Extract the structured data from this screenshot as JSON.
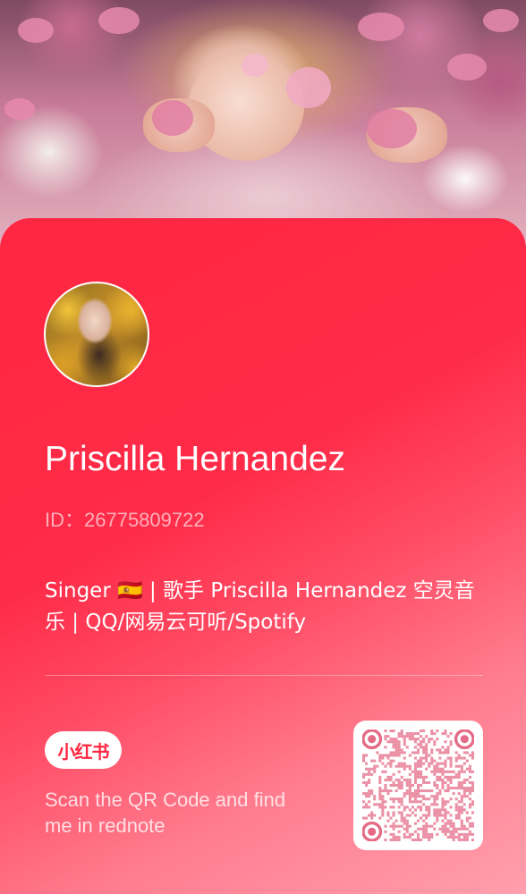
{
  "profile": {
    "name": "Priscilla Hernandez",
    "id_text": "ID：26775809722",
    "bio": "Singer  🇪🇸 | 歌手 Priscilla Hernandez 空灵音乐 | QQ/网易云可听/Spotify"
  },
  "brand": {
    "badge_label": "小红书",
    "accent_color": "#ff2741"
  },
  "qr": {
    "caption": "Scan the QR Code and find me in rednote",
    "module_color": "#e46a86"
  },
  "icons": {
    "avatar": "avatar-image",
    "hero": "hero-photo",
    "qr": "qr-code-icon"
  }
}
